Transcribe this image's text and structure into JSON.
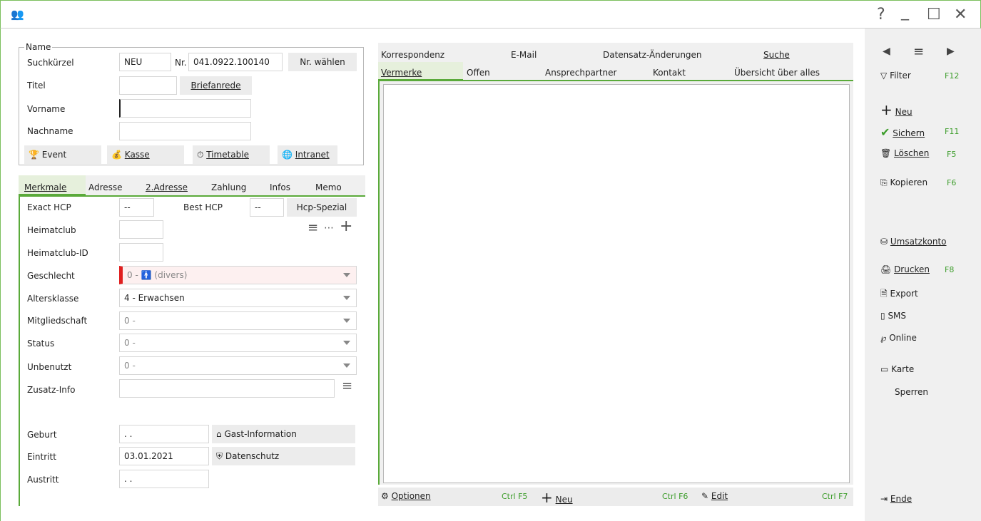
{
  "window": {
    "icon": "people-icon",
    "help": "?",
    "minimize": "_",
    "maximize": "☐",
    "close": "✕"
  },
  "name_group": {
    "legend": "Name",
    "suchkuerzel_label": "Suchkürzel",
    "suchkuerzel_value": "NEU",
    "nr_label": "Nr.",
    "nr_value": "041.0922.100140",
    "nr_waehlen": "Nr. wählen",
    "titel_label": "Titel",
    "titel_value": "",
    "briefanrede": "Briefanrede",
    "vorname_label": "Vorname",
    "vorname_value": "",
    "nachname_label": "Nachname",
    "nachname_value": "",
    "buttons": [
      "Event",
      "Kasse",
      "Timetable",
      "Intranet"
    ]
  },
  "left_tabs": [
    "Merkmale",
    "Adresse",
    "2.Adresse",
    "Zahlung",
    "Infos",
    "Memo"
  ],
  "merkmale": {
    "exact_hcp_label": "Exact HCP",
    "exact_hcp_value": "--",
    "best_hcp_label": "Best HCP",
    "best_hcp_value": "--",
    "hcp_spezial": "Hcp-Spezial",
    "heimatclub_label": "Heimatclub",
    "heimatclub_id_label": "Heimatclub-ID",
    "geschlecht_label": "Geschlecht",
    "geschlecht_value_a": "0 -",
    "geschlecht_value_b": "(divers)",
    "altersklasse_label": "Altersklasse",
    "altersklasse_value": "4 - Erwachsen",
    "mitgliedschaft_label": "Mitgliedschaft",
    "mitgliedschaft_value": "0 -",
    "status_label": "Status",
    "status_value": "0 -",
    "unbenutzt_label": "Unbenutzt",
    "unbenutzt_value": "0 -",
    "zusatz_label": "Zusatz-Info",
    "geburt_label": "Geburt",
    "geburt_value": ". .",
    "gast_info": "Gast-Information",
    "eintritt_label": "Eintritt",
    "eintritt_value": "03.01.2021",
    "datenschutz": "Datenschutz",
    "austritt_label": "Austritt",
    "austritt_value": ". ."
  },
  "right_tabs_row1": [
    "Korrespondenz",
    "E-Mail",
    "Datensatz-Änderungen",
    "Suche"
  ],
  "right_tabs_row2": [
    "Vermerke",
    "Offen",
    "Ansprechpartner",
    "Kontakt",
    "Übersicht über alles"
  ],
  "bottom_bar": {
    "optionen": "Optionen",
    "optionen_key": "Ctrl F5",
    "neu": "Neu",
    "neu_key": "Ctrl F6",
    "edit": "Edit",
    "edit_key": "Ctrl F7"
  },
  "sidebar": {
    "filter": "Filter",
    "filter_key": "F12",
    "neu": "Neu",
    "sichern": "Sichern",
    "sichern_key": "F11",
    "loeschen": "Löschen",
    "loeschen_key": "F5",
    "kopieren": "Kopieren",
    "kopieren_key": "F6",
    "umsatzkonto": "Umsatzkonto",
    "drucken": "Drucken",
    "drucken_key": "F8",
    "export": "Export",
    "sms": "SMS",
    "online": "Online",
    "karte": "Karte",
    "sperren": "Sperren",
    "ende": "Ende"
  },
  "colors": {
    "accent": "#5aaa3a",
    "key": "#3c9d2a",
    "required": "#e02020"
  }
}
